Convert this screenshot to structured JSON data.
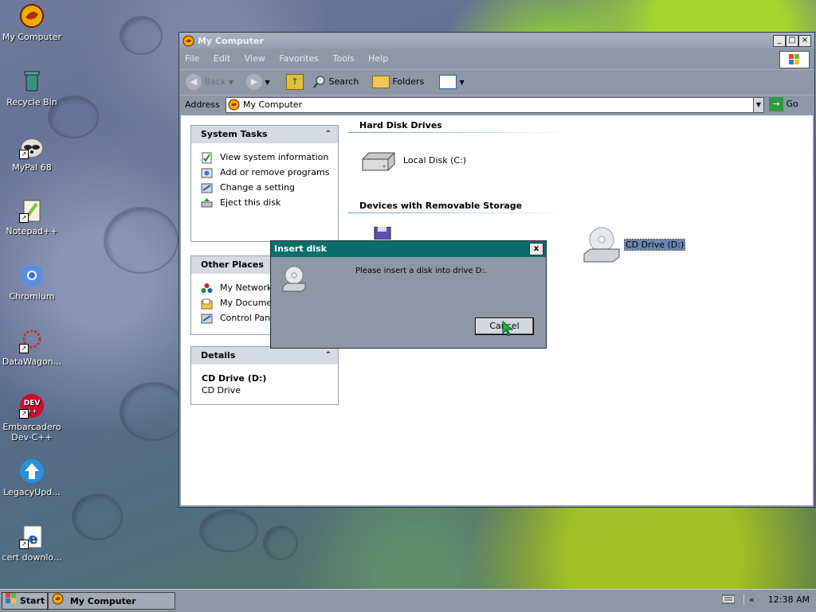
{
  "desktop": {
    "icons": [
      {
        "label": "My Computer"
      },
      {
        "label": "Recycle Bin"
      },
      {
        "label": "MyPal 68"
      },
      {
        "label": "Notepad++"
      },
      {
        "label": "Chromium"
      },
      {
        "label": "DataWagon..."
      },
      {
        "label": "Embarcadero Dev-C++"
      },
      {
        "label": "LegacyUpd..."
      },
      {
        "label": "cert downlo..."
      }
    ]
  },
  "window": {
    "title": "My Computer",
    "menu": [
      "File",
      "Edit",
      "View",
      "Favorites",
      "Tools",
      "Help"
    ],
    "toolbar": {
      "back": "Back",
      "search": "Search",
      "folders": "Folders"
    },
    "address": {
      "label": "Address",
      "value": "My Computer",
      "go": "Go"
    },
    "system_tasks": {
      "title": "System Tasks",
      "items": [
        "View system information",
        "Add or remove programs",
        "Change a setting",
        "Eject this disk"
      ]
    },
    "other_places": {
      "title": "Other Places",
      "items": [
        "My Network",
        "My Docume",
        "Control Pan"
      ]
    },
    "details": {
      "title": "Details",
      "name": "CD Drive (D:)",
      "type": "CD Drive"
    },
    "sections": {
      "hard_disks": {
        "title": "Hard Disk Drives",
        "items": [
          "Local Disk (C:)"
        ]
      },
      "removable": {
        "title": "Devices with Removable Storage",
        "items": [
          "CD Drive (D:)"
        ]
      }
    }
  },
  "dialog": {
    "title": "Insert disk",
    "message": "Please insert a disk into drive D:.",
    "cancel": "Cancel",
    "close": "x"
  },
  "taskbar": {
    "start": "Start",
    "task": "My Computer",
    "tray_chevron": "«",
    "clock": "12:38 AM"
  }
}
